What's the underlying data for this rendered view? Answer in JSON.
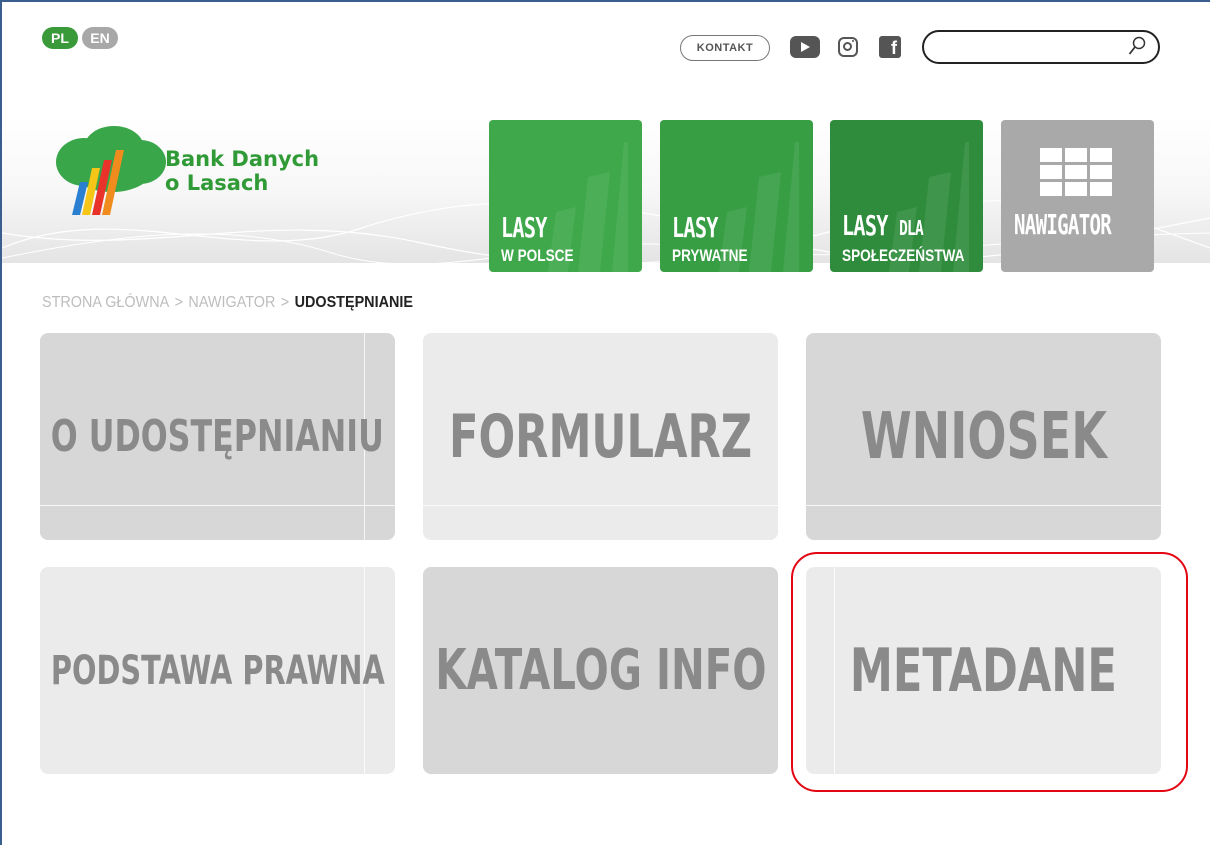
{
  "lang": {
    "pl": "PL",
    "en": "EN"
  },
  "top": {
    "contact_label": "KONTAKT",
    "search_placeholder": "",
    "icons": [
      "youtube-icon",
      "instagram-icon",
      "facebook-icon",
      "search-icon"
    ]
  },
  "brand": {
    "line1": "Bank Danych",
    "line2": "o Lasach"
  },
  "nav_tiles": [
    {
      "line1": "LASY",
      "line2": "W POLSCE"
    },
    {
      "line1": "LASY",
      "line2": "PRYWATNE"
    },
    {
      "line1": "LASY",
      "line1b": "DLA",
      "line2": "SPOŁECZEŃSTWA"
    },
    {
      "line1": "NAWIGATOR"
    }
  ],
  "breadcrumb": [
    "STRONA GŁÓWNA",
    "NAWIGATOR",
    "UDOSTĘPNIANIE"
  ],
  "breadcrumb_sep": ">",
  "cards": [
    "O UDOSTĘPNIANIU",
    "FORMULARZ",
    "WNIOSEK",
    "PODSTAWA PRAWNA",
    "KATALOG INFO",
    "METADANE"
  ],
  "colors": {
    "brand_green": "#2f9a36",
    "tile_green_1": "#3ea84a",
    "tile_green_2": "#379e44",
    "tile_green_3": "#2f8c3c",
    "tile_gray": "#a9a9a9",
    "highlight_red": "#e30613"
  }
}
